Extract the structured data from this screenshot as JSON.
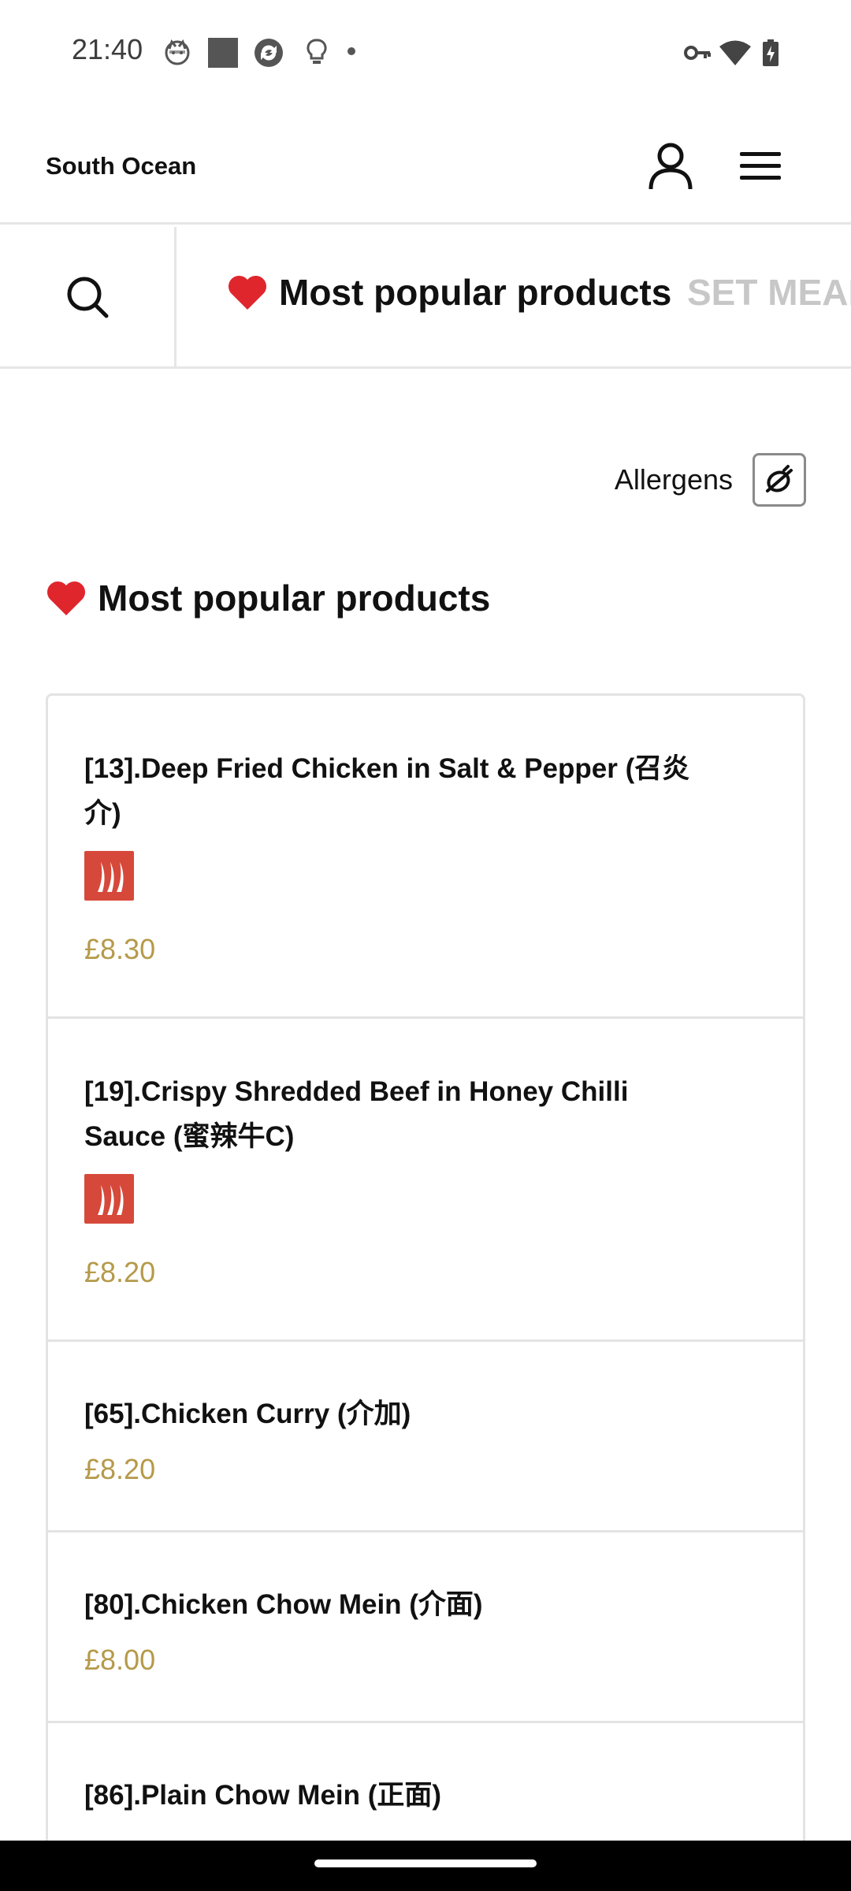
{
  "status_bar": {
    "time": "21:40",
    "left_icons": [
      "cat-face-icon",
      "square-icon",
      "sync-icon",
      "lightbulb-icon",
      "dot-icon"
    ],
    "right_icons": [
      "vpn-key-icon",
      "wifi-icon",
      "battery-charging-icon"
    ]
  },
  "header": {
    "store_name": "South Ocean",
    "account_icon": "person-icon",
    "menu_icon": "hamburger-menu-icon"
  },
  "tabs": [
    {
      "label": "Most popular products",
      "emoji_icon": "heart-icon",
      "active": true
    },
    {
      "label": "SET MEAL",
      "active": false
    }
  ],
  "allergens": {
    "label": "Allergens",
    "icon": "no-allergen-icon"
  },
  "section": {
    "title": "Most popular products",
    "icon": "heart-icon"
  },
  "products": [
    {
      "name": "[13].Deep Fried Chicken in Salt & Pepper (召炎介)",
      "price": "£8.30",
      "spicy": true
    },
    {
      "name": "[19].Crispy Shredded Beef in Honey Chilli Sauce (蜜辣牛C)",
      "price": "£8.20",
      "spicy": true
    },
    {
      "name": "[65].Chicken Curry (介加)",
      "price": "£8.20",
      "spicy": false
    },
    {
      "name": "[80].Chicken Chow Mein (介面)",
      "price": "£8.00",
      "spicy": false
    },
    {
      "name": "[86].Plain Chow Mein (正面)",
      "price": "",
      "spicy": false
    }
  ],
  "colors": {
    "price": "#b59a4a",
    "spicy_badge": "#d6493a",
    "heart": "#e0262d",
    "inactive_tab": "#c7c7c7",
    "divider": "#e3e3e3"
  }
}
